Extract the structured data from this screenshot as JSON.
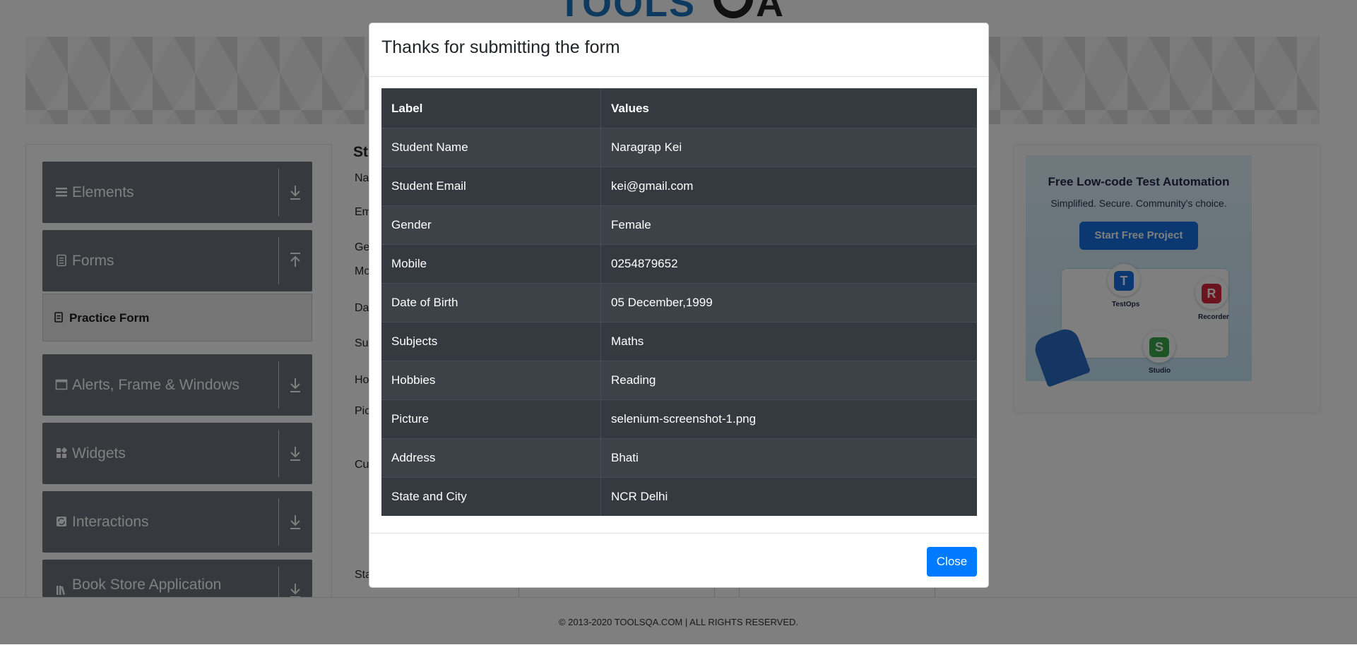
{
  "brand": {
    "logo_alt": "TOOLSQA"
  },
  "sidebar": {
    "groups": [
      {
        "label": "Elements",
        "icon": "hamburger-icon"
      },
      {
        "label": "Forms",
        "icon": "document-icon"
      },
      {
        "label": "Alerts, Frame & Windows",
        "icon": "window-icon"
      },
      {
        "label": "Widgets",
        "icon": "widgets-icon"
      },
      {
        "label": "Interactions",
        "icon": "interactions-icon"
      },
      {
        "label": "Book Store Application",
        "icon": "books-icon"
      }
    ],
    "active_item": {
      "label": "Practice Form",
      "icon": "practice-form-icon"
    }
  },
  "form": {
    "title_fragment": "St",
    "label_fragments": [
      "Na",
      "Em",
      "Ge",
      "Mo",
      "Da",
      "Su",
      "Ho",
      "Pic",
      "Cu",
      "Sta"
    ]
  },
  "ad": {
    "title": "Free Low-code Test Automation",
    "subtitle": "Simplified. Secure. Community's choice.",
    "button": "Start Free Project",
    "products": [
      {
        "letter": "T",
        "name": "TestOps",
        "color": "#1671e0"
      },
      {
        "letter": "R",
        "name": "Recorder",
        "color": "#d9263a"
      },
      {
        "letter": "S",
        "name": "Studio",
        "color": "#3aa84b"
      }
    ]
  },
  "footer": {
    "text": "© 2013-2020 TOOLSQA.COM | ALL RIGHTS RESERVED."
  },
  "modal": {
    "title": "Thanks for submitting the form",
    "table": {
      "headers": [
        "Label",
        "Values"
      ],
      "rows": [
        [
          "Student Name",
          "Naragrap Kei"
        ],
        [
          "Student Email",
          "kei@gmail.com"
        ],
        [
          "Gender",
          "Female"
        ],
        [
          "Mobile",
          "0254879652"
        ],
        [
          "Date of Birth",
          "05 December,1999"
        ],
        [
          "Subjects",
          "Maths"
        ],
        [
          "Hobbies",
          "Reading"
        ],
        [
          "Picture",
          "selenium-screenshot-1.png"
        ],
        [
          "Address",
          "Bhati"
        ],
        [
          "State and City",
          "NCR Delhi"
        ]
      ]
    },
    "close_label": "Close"
  },
  "colors": {
    "primary": "#007bff",
    "table_dark": "#343a40",
    "sidebar_group": "#6c757d"
  }
}
